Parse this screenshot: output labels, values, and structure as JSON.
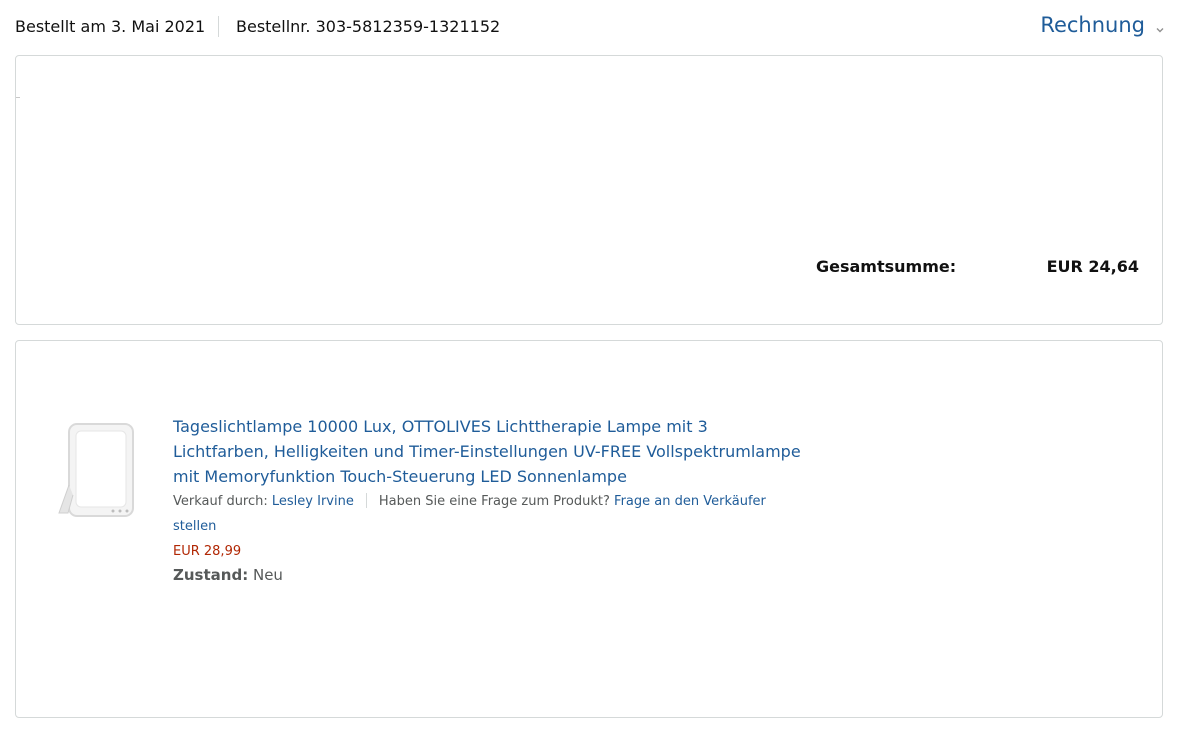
{
  "header": {
    "order_date": "Bestellt am 3. Mai 2021",
    "order_number": "Bestellnr. 303-5812359-1321152",
    "invoice_label": "Rechnung",
    "chevron_icon": "chevron-down-icon"
  },
  "summary": {
    "total_label": "Gesamtsumme:",
    "total_value": "EUR 24,64"
  },
  "item": {
    "image_icon": "daylight-lamp-image",
    "title": "Tageslichtlampe 10000 Lux, OTTOLIVES Lichttherapie Lampe mit 3 Lichtfarben, Helligkeiten und Timer-Einstellungen UV-FREE Vollspektrumlampe mit Memoryfunktion Touch-Steuerung LED Sonnenlampe",
    "seller_prefix": "Verkauf durch: ",
    "seller_name": "Lesley Irvine",
    "question_text": "Haben Sie eine Frage zum Produkt? ",
    "question_link": "Frage an den Verkäufer stellen",
    "price": "EUR 28,99",
    "condition_label": "Zustand:",
    "condition_value": "Neu"
  },
  "colors": {
    "link": "#1f5c99",
    "price": "#b12704",
    "border": "#d5d9d9",
    "muted_text": "#565959"
  }
}
